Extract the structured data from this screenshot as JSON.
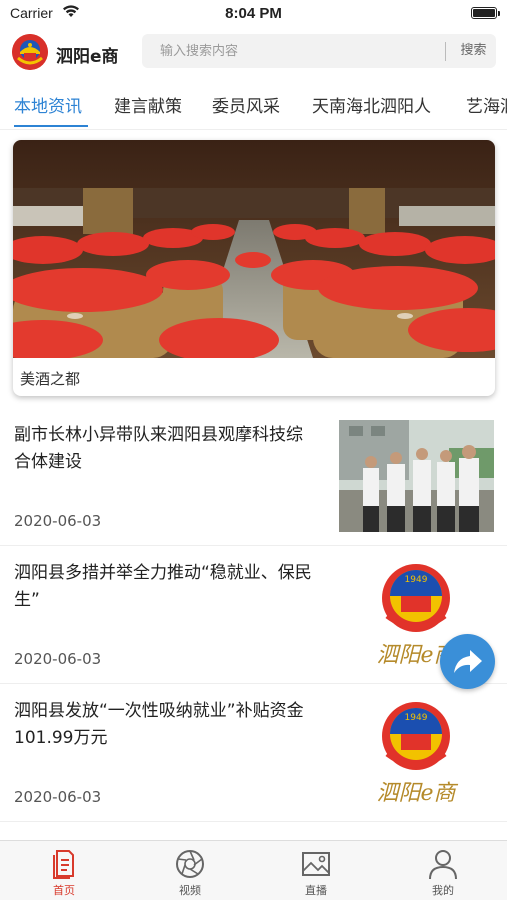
{
  "status_bar": {
    "carrier": "Carrier",
    "time": "8:04 PM"
  },
  "header": {
    "app_name": "泗阳e商",
    "search_placeholder": "输入搜索内容",
    "search_button": "搜索"
  },
  "tabs": [
    {
      "label": "本地资讯",
      "active": true
    },
    {
      "label": "建言献策"
    },
    {
      "label": "委员风采"
    },
    {
      "label": "天南海北泗阳人"
    },
    {
      "label": "艺海泗阳"
    }
  ],
  "banner": {
    "caption": "美酒之都"
  },
  "news": [
    {
      "title": "副市长林小异带队来泗阳县观摩科技综合体建设",
      "date": "2020-06-03",
      "thumb": "photo-officials"
    },
    {
      "title": "泗阳县多措并举全力推动“稳就业、保民生”",
      "date": "2020-06-03",
      "thumb": "cppcc-emblem-logo"
    },
    {
      "title": "泗阳县发放“一次性吸纳就业”补贴资金101.99万元",
      "date": "2020-06-03",
      "thumb": "cppcc-emblem-logo"
    }
  ],
  "emblem_text": {
    "year": "1949",
    "logo_script": "泗阳e商"
  },
  "tab_bar": [
    {
      "label": "首页",
      "icon": "home-document-icon",
      "active": true
    },
    {
      "label": "视频",
      "icon": "camera-aperture-icon"
    },
    {
      "label": "直播",
      "icon": "picture-icon"
    },
    {
      "label": "我的",
      "icon": "user-icon"
    }
  ],
  "colors": {
    "accent": "#2d83d4",
    "active_tab_bar": "#d83a2c",
    "fab": "#3a8fd8"
  }
}
